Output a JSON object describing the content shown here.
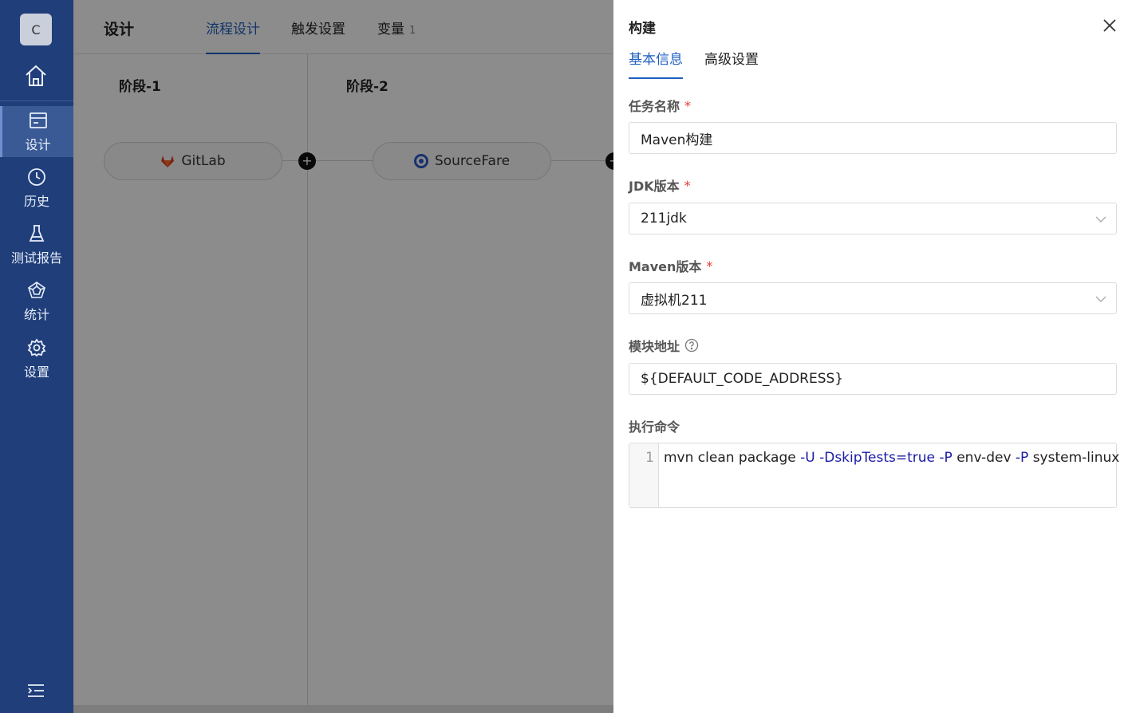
{
  "sidebar": {
    "avatar": "C",
    "items": [
      {
        "label": "设计",
        "icon": "design-icon",
        "active": true
      },
      {
        "label": "历史",
        "icon": "history-icon"
      },
      {
        "label": "测试报告",
        "icon": "flask-icon"
      },
      {
        "label": "统计",
        "icon": "statistics-icon"
      },
      {
        "label": "设置",
        "icon": "settings-icon"
      }
    ]
  },
  "header": {
    "title": "设计",
    "tabs": [
      {
        "label": "流程设计",
        "active": true
      },
      {
        "label": "触发设置"
      },
      {
        "label": "变量",
        "badge": "1"
      }
    ]
  },
  "pipeline": {
    "stages": [
      {
        "title": "阶段-1",
        "node": "GitLab",
        "icon": "gitlab-icon"
      },
      {
        "title": "阶段-2",
        "node": "SourceFare",
        "icon": "sourcefare-icon"
      }
    ]
  },
  "drawer": {
    "title": "构建",
    "tabs": [
      {
        "label": "基本信息",
        "active": true
      },
      {
        "label": "高级设置"
      }
    ],
    "fields": {
      "task_name": {
        "label": "任务名称",
        "value": "Maven构建",
        "required": "*"
      },
      "jdk": {
        "label": "JDK版本",
        "value": "211jdk",
        "required": "*"
      },
      "maven": {
        "label": "Maven版本",
        "value": "虚拟机211",
        "required": "*"
      },
      "module": {
        "label": "模块地址",
        "value": "${DEFAULT_CODE_ADDRESS}"
      },
      "command": {
        "label": "执行命令",
        "line_number": "1",
        "tokens": [
          "mvn clean package ",
          "-U",
          " ",
          "-DskipTests",
          "=true ",
          "-P",
          " env-dev ",
          "-P",
          " system-linux"
        ]
      }
    }
  },
  "colors": {
    "sidebar": "#1f3e7a",
    "accent": "#1f5fbf",
    "required": "#e53935"
  }
}
